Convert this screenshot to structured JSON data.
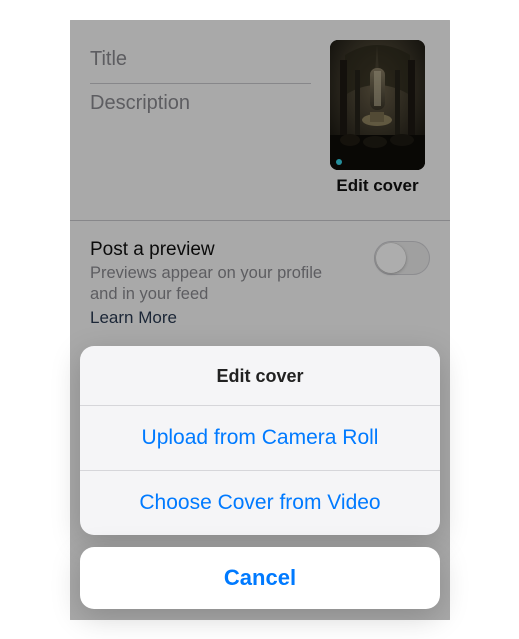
{
  "form": {
    "title_placeholder": "Title",
    "description_placeholder": "Description"
  },
  "cover": {
    "edit_label": "Edit cover"
  },
  "preview": {
    "title": "Post a preview",
    "subtitle": "Previews appear on your profile and in your feed",
    "learn_more": "Learn More",
    "enabled": false
  },
  "sheet": {
    "title": "Edit cover",
    "options": [
      "Upload from Camera Roll",
      "Choose Cover from Video"
    ],
    "cancel": "Cancel"
  },
  "colors": {
    "ios_blue": "#007aff",
    "muted_text": "#8a8a8f"
  }
}
